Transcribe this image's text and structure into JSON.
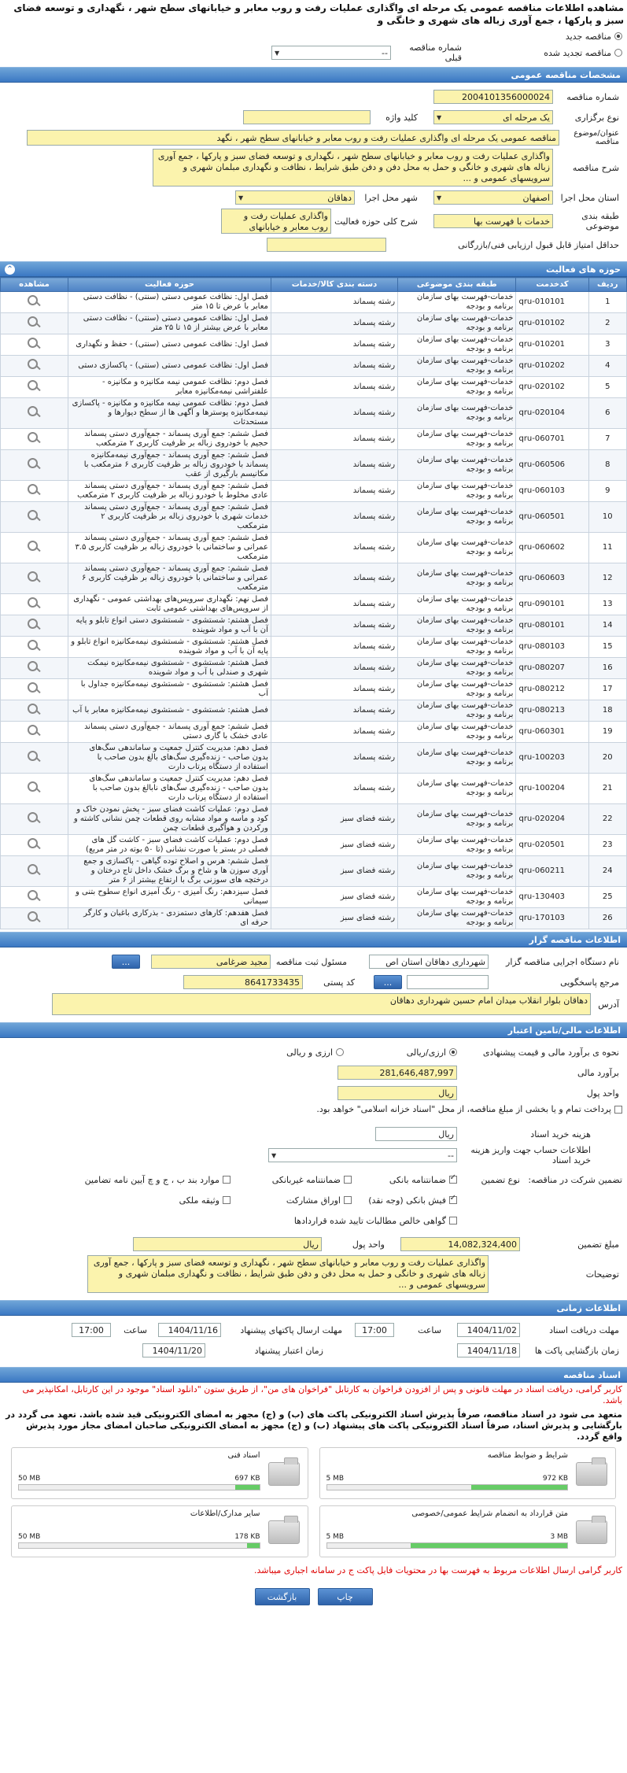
{
  "page_title": "مشاهده اطلاعات مناقصه عمومی یک مرحله ای واگذاری عملیات رفت و روب معابر و خیابانهای سطح شهر ، نگهداری و توسعه فضای سبز و پارکها ، جمع آوری زباله های شهری و خانگی و",
  "top": {
    "new_tender": "مناقصه جدید",
    "renewed_tender": "مناقصه تجدید شده",
    "prev_tender_label": "شماره مناقصه قبلی",
    "prev_tender_value": "--"
  },
  "general": {
    "header": "مشخصات مناقصه عمومی",
    "tender_no_label": "شماره مناقصه",
    "tender_no": "2004101356000024",
    "type_label": "نوع برگزاری",
    "type_value": "یک مرحله ای",
    "keyword_label": "کلید واژه",
    "keyword_value": "",
    "subject_label": "عنوان/موضوع مناقصه",
    "subject_value": "مناقصه عمومی یک مرحله ای واگذاری عملیات رفت و روب  معابر و خیابانهای سطح شهر ، نگهد",
    "desc_label": "شرح مناقصه",
    "desc_value": "واگذاری عملیات رفت و روب  معابر و خیابانهای سطح شهر ، نگهداری  و توسعه فضای سبز و پارکها ، جمع آوری زباله های شهری و خانگی و حمل به محل دفن  و دفن طبق شرایط ، نظافت و نگهداری مبلمان شهری و سرویسهای عمومی و ...",
    "province_label": "استان محل اجرا",
    "province_value": "اصفهان",
    "city_label": "شهر محل اجرا",
    "city_value": "دهاقان",
    "category_label": "طبقه بندی موضوعی",
    "category_value": "خدمات با فهرست بها",
    "scope_label": "شرح کلی حوزه فعالیت",
    "scope_value": "واگذاری عملیات رفت و روب معابر و خیابانهای سطح",
    "min_score_label": "حداقل امتیاز قابل قبول ارزیابی فنی/بازرگانی",
    "min_score_value": ""
  },
  "activities": {
    "header": "حوزه های فعالیت",
    "columns": [
      "ردیف",
      "کدخدمت",
      "طبقه بندی موضوعی",
      "دسته بندی کالا/خدمات",
      "حوزه فعالیت",
      "مشاهده"
    ],
    "rows": [
      {
        "i": "1",
        "code": "qru-010101",
        "cat": "خدمات-فهرست بهای سازمان برنامه و بودجه",
        "grp": "رشته پسماند",
        "dom": "فصل اول: نظافت عمومی دستی (سنتی) - نظافت دستی معابر با عرض تا ۱۵ متر"
      },
      {
        "i": "2",
        "code": "qru-010102",
        "cat": "خدمات-فهرست بهای سازمان برنامه و بودجه",
        "grp": "رشته پسماند",
        "dom": "فصل اول: نظافت عمومی دستی (سنتی) - نظافت دستی معابر با عرض بیشتر از ۱۵ تا ۲۵ متر"
      },
      {
        "i": "3",
        "code": "qru-010201",
        "cat": "خدمات-فهرست بهای سازمان برنامه و بودجه",
        "grp": "رشته پسماند",
        "dom": "فصل اول: نظافت عمومی دستی (سنتی) - حفظ و نگهداری"
      },
      {
        "i": "4",
        "code": "qru-010202",
        "cat": "خدمات-فهرست بهای سازمان برنامه و بودجه",
        "grp": "رشته پسماند",
        "dom": "فصل اول: نظافت عمومی دستی (سنتی) - پاکسازی دستی"
      },
      {
        "i": "5",
        "code": "qru-020102",
        "cat": "خدمات-فهرست بهای سازمان برنامه و بودجه",
        "grp": "رشته پسماند",
        "dom": "فصل دوم: نظافت عمومی نیمه مکانیزه و مکانیزه - علفتراشی نیمه‌مکانیزه معابر"
      },
      {
        "i": "6",
        "code": "qru-020104",
        "cat": "خدمات-فهرست بهای سازمان برنامه و بودجه",
        "grp": "رشته پسماند",
        "dom": "فصل دوم: نظافت عمومی نیمه مکانیزه و مکانیزه - پاکسازی نیمه‌مکانیزه پوسترها و آگهی ها از سطح دیوارها و مستحدثات"
      },
      {
        "i": "7",
        "code": "qru-060701",
        "cat": "خدمات-فهرست بهای سازمان برنامه و بودجه",
        "grp": "رشته پسماند",
        "dom": "فصل ششم: جمع آوری پسماند - جمع‌آوری دستی پسماند حجیم با خودروی زباله بر ظرفیت کاربری ۲ مترمکعب"
      },
      {
        "i": "8",
        "code": "qru-060506",
        "cat": "خدمات-فهرست بهای سازمان برنامه و بودجه",
        "grp": "رشته پسماند",
        "dom": "فصل ششم: جمع آوری پسماند - جمع‌آوری نیمه‌مکانیزه پسماند با خودروی زباله بر ظرفیت کاربری ۶ مترمکعب با مکانیسم بارگیری از عقب"
      },
      {
        "i": "9",
        "code": "qru-060103",
        "cat": "خدمات-فهرست بهای سازمان برنامه و بودجه",
        "grp": "رشته پسماند",
        "dom": "فصل ششم: جمع آوری پسماند - جمع‌آوری دستی پسماند عادی مخلوط با خودرو زباله بر ظرفیت کاربری ۲ مترمکعب"
      },
      {
        "i": "10",
        "code": "qru-060501",
        "cat": "خدمات-فهرست بهای سازمان برنامه و بودجه",
        "grp": "رشته پسماند",
        "dom": "فصل ششم: جمع آوری پسماند - جمع‌آوری دستی پسماند خدمات شهری با خودروی زباله بر ظرفیت کاربری ۲ مترمکعب"
      },
      {
        "i": "11",
        "code": "qru-060602",
        "cat": "خدمات-فهرست بهای سازمان برنامه و بودجه",
        "grp": "رشته پسماند",
        "dom": "فصل ششم: جمع آوری پسماند - جمع‌آوری دستی پسماند عمرانی و ساختمانی با خودروی زباله بر ظرفیت کاربری ۳.۵ مترمکعب"
      },
      {
        "i": "12",
        "code": "qru-060603",
        "cat": "خدمات-فهرست بهای سازمان برنامه و بودجه",
        "grp": "رشته پسماند",
        "dom": "فصل ششم: جمع آوری پسماند - جمع‌آوری دستی پسماند عمرانی و ساختمانی با خودروی زباله بر ظرفیت کاربری ۶ مترمکعب"
      },
      {
        "i": "13",
        "code": "qru-090101",
        "cat": "خدمات-فهرست بهای سازمان برنامه و بودجه",
        "grp": "رشته پسماند",
        "dom": "فصل نهم: نگهداری سرویس‌های بهداشتی عمومی - نگهداری از سرویس‌های بهداشتی عمومی ثابت"
      },
      {
        "i": "14",
        "code": "qru-080101",
        "cat": "خدمات-فهرست بهای سازمان برنامه و بودجه",
        "grp": "رشته پسماند",
        "dom": "فصل هشتم: شستشوی - شستشوی دستی انواع تابلو و پایه آن با آب و مواد شوینده"
      },
      {
        "i": "15",
        "code": "qru-080103",
        "cat": "خدمات-فهرست بهای سازمان برنامه و بودجه",
        "grp": "رشته پسماند",
        "dom": "فصل هشتم: شستشوی - شستشوی نیمه‌مکانیزه انواع تابلو و پایه آن با آب و مواد شوینده"
      },
      {
        "i": "16",
        "code": "qru-080207",
        "cat": "خدمات-فهرست بهای سازمان برنامه و بودجه",
        "grp": "رشته پسماند",
        "dom": "فصل هشتم: شستشوی - شستشوی نیمه‌مکانیزه نیمکت شهری و صندلی با آب و مواد شوینده"
      },
      {
        "i": "17",
        "code": "qru-080212",
        "cat": "خدمات-فهرست بهای سازمان برنامه و بودجه",
        "grp": "رشته پسماند",
        "dom": "فصل هشتم: شستشوی - شستشوی نیمه‌مکانیزه جداول با آب"
      },
      {
        "i": "18",
        "code": "qru-080213",
        "cat": "خدمات-فهرست بهای سازمان برنامه و بودجه",
        "grp": "رشته پسماند",
        "dom": "فصل هشتم: شستشوی - شستشوی نیمه‌مکانیزه معابر با آب"
      },
      {
        "i": "19",
        "code": "qru-060301",
        "cat": "خدمات-فهرست بهای سازمان برنامه و بودجه",
        "grp": "رشته پسماند",
        "dom": "فصل ششم: جمع آوری پسماند - جمع‌آوری دستی پسماند عادی خشک با گاری دستی"
      },
      {
        "i": "20",
        "code": "qru-100203",
        "cat": "خدمات-فهرست بهای سازمان برنامه و بودجه",
        "grp": "رشته پسماند",
        "dom": "فصل دهم: مدیریت کنترل جمعیت و ساماندهی سگ‌های بدون صاحب - زنده‌گیری سگ‌های بالغ بدون صاحب با استفاده از دستگاه پرتاب دارت"
      },
      {
        "i": "21",
        "code": "qru-100204",
        "cat": "خدمات-فهرست بهای سازمان برنامه و بودجه",
        "grp": "رشته پسماند",
        "dom": "فصل دهم: مدیریت کنترل جمعیت و ساماندهی سگ‌های بدون صاحب - زنده‌گیری سگ‌های نابالغ بدون صاحب با استفاده از دستگاه پرتاب دارت"
      },
      {
        "i": "22",
        "code": "qru-020204",
        "cat": "خدمات-فهرست بهای سازمان برنامه و بودجه",
        "grp": "رشته فضای سبز",
        "dom": "فصل دوم: عملیات کاشت فضای سبز - پخش نمودن خاک و کود و ماسه و مواد مشابه روی قطعات چمن نشانی کاشته و ورکردن و هوآگیری قطعات چمن"
      },
      {
        "i": "23",
        "code": "qru-020501",
        "cat": "خدمات-فهرست بهای سازمان برنامه و بودجه",
        "grp": "رشته فضای سبز",
        "dom": "فصل دوم: عملیات کاشت فضای سبز - کاشت گل های فصلی در بستر یا صورت نشانی (تا ۵۰ بوته در متر مربع)"
      },
      {
        "i": "24",
        "code": "qru-060211",
        "cat": "خدمات-فهرست بهای سازمان برنامه و بودجه",
        "grp": "رشته فضای سبز",
        "dom": "فصل ششم: هرس و اصلاح توده گیاهی - پاکسازی و جمع آوری سوزن ها و شاخ و برگ خشک داخل تاج درختان و درختچه های سوزنی برگ با ارتفاع بیشتر از ۶ متر"
      },
      {
        "i": "25",
        "code": "qru-130403",
        "cat": "خدمات-فهرست بهای سازمان برنامه و بودجه",
        "grp": "رشته فضای سبز",
        "dom": "فصل سیزدهم: رنگ آمیزی - رنگ آمیزی انواع سطوح بتنی و سیمانی"
      },
      {
        "i": "26",
        "code": "qru-170103",
        "cat": "خدمات-فهرست بهای سازمان برنامه و بودجه",
        "grp": "رشته فضای سبز",
        "dom": "فصل هفدهم: کارهای دستمزدی - بذرکاری باغبان و کارگر حرفه ای"
      }
    ]
  },
  "organizer": {
    "header": "اطلاعات مناقصه گزار",
    "org_label": "نام دستگاه اجرایی مناقصه گزار",
    "org_value": "شهرداری دهاقان استان اص",
    "officer_label": "مسئول ثبت مناقصه",
    "officer_value": "مجید ضرغامی",
    "ref_label": "مرجع پاسخگویی",
    "ref_value": "",
    "postal_label": "کد پستی",
    "postal_value": "8641733435",
    "address_label": "آدرس",
    "address_value": "دهاقان بلوار انقلاب میدان امام حسین شهرداری دهاقان",
    "dots": "..."
  },
  "financial": {
    "header": "اطلاعات مالی/تامین اعتبار",
    "estimate_type_label": "نحوه ی برآورد مالی و قیمت پیشنهادی",
    "opt_rial": "ارزی/ریالی",
    "opt_fx": "ارزی و ریالی",
    "estimate_label": "برآورد مالی",
    "estimate_value": "281,646,487,997",
    "currency_label": "واحد پول",
    "currency_value": "ریال",
    "treasury_note": "پرداخت تمام و یا بخشی از مبلغ مناقصه، از محل \"اسناد خزانه اسلامی\" خواهد بود.",
    "doc_fee_label": "هزینه خرید اسناد",
    "doc_fee_unit": "ریال",
    "doc_fee_value": "",
    "account_label": "اطلاعات حساب جهت واریز هزینه خرید اسناد",
    "account_value": "--",
    "guarantee_label": "تضمین شرکت در مناقصه:",
    "guarantee_type_label": "نوع تضمین",
    "g_bank": "ضمانتنامه بانکی",
    "g_nonbank": "ضمانتنامه غیربانکی",
    "g_items": "موارد بند ب ، ج و چ آیین نامه تضامین",
    "g_check": "فیش بانکی (وجه نقد)",
    "g_bonds": "اوراق مشارکت",
    "g_property": "وثیقه ملکی",
    "g_receivable": "گواهی خالص مطالبات تایید شده قراردادها",
    "amount_label": "مبلغ تضمین",
    "amount_value": "14,082,324,400",
    "amount_unit_label": "واحد پول",
    "amount_unit_value": "ریال",
    "notes_label": "توضیحات",
    "notes_value": "واگذاری عملیات رفت و روب  معابر و خیابانهای سطح شهر ، نگهداری  و توسعه فضای سبز و پارکها ، جمع آوری زباله های شهری و خانگی و حمل به محل دفن  و دفن طبق شرایط ، نظافت و نگهداری مبلمان شهری و سرویسهای عمومی و ..."
  },
  "timing": {
    "header": "اطلاعات زمانی",
    "receive_label": "مهلت دریافت اسناد",
    "receive_date": "1404/11/02",
    "receive_time": "17:00",
    "send_label": "مهلت ارسال پاکتهای پیشنهاد",
    "send_date": "1404/11/16",
    "send_time": "17:00",
    "open_label": "زمان بازگشایی پاکت ها",
    "open_date": "1404/11/18",
    "validity_label": "زمان اعتبار پیشنهاد",
    "validity_date": "1404/11/20",
    "time_label": "ساعت"
  },
  "docs": {
    "header": "اسناد مناقصه",
    "note1": "کاربر گرامی، دریافت اسناد در مهلت قانونی و پس از افزودن فراخوان به کارتابل \"فراخوان های من\"، از طریق ستون \"دانلود اسناد\" موجود در این کارتابل، امکانپذیر می باشد.",
    "note2": "متعهد می شود در اسناد مناقصه، صرفاً پذیرش اسناد الکترونیکی پاکت های (ب) و (ج) مجهز به امضای الکترونیکی قید شده باشد. تعهد می گردد در بارگشایی و پذیرش اسناد، صرفاً اسناد الکترونیکی پاکت های پیشنهاد (ب) و (ج) مجهز به امضای الکترونیکی صاحبان امضای مجاز مورد پذیرش واقع گردد.",
    "files": [
      {
        "title": "شرایط و ضوابط مناقصه",
        "size": "972 KB",
        "max": "5 MB",
        "pct": 40
      },
      {
        "title": "اسناد فنی",
        "size": "697 KB",
        "max": "50 MB",
        "pct": 10
      },
      {
        "title": "متن قرارداد به انضمام شرایط عمومی/خصوصی",
        "size": "3 MB",
        "max": "5 MB",
        "pct": 65
      },
      {
        "title": "سایر مدارک/اطلاعات",
        "size": "178 KB",
        "max": "50 MB",
        "pct": 5
      }
    ],
    "note3": "کاربر گرامی ارسال اطلاعات مربوط به فهرست بها در محتویات فایل پاکت ج در سامانه اجباری میباشد."
  },
  "buttons": {
    "print": "چاپ",
    "back": "بازگشت"
  }
}
